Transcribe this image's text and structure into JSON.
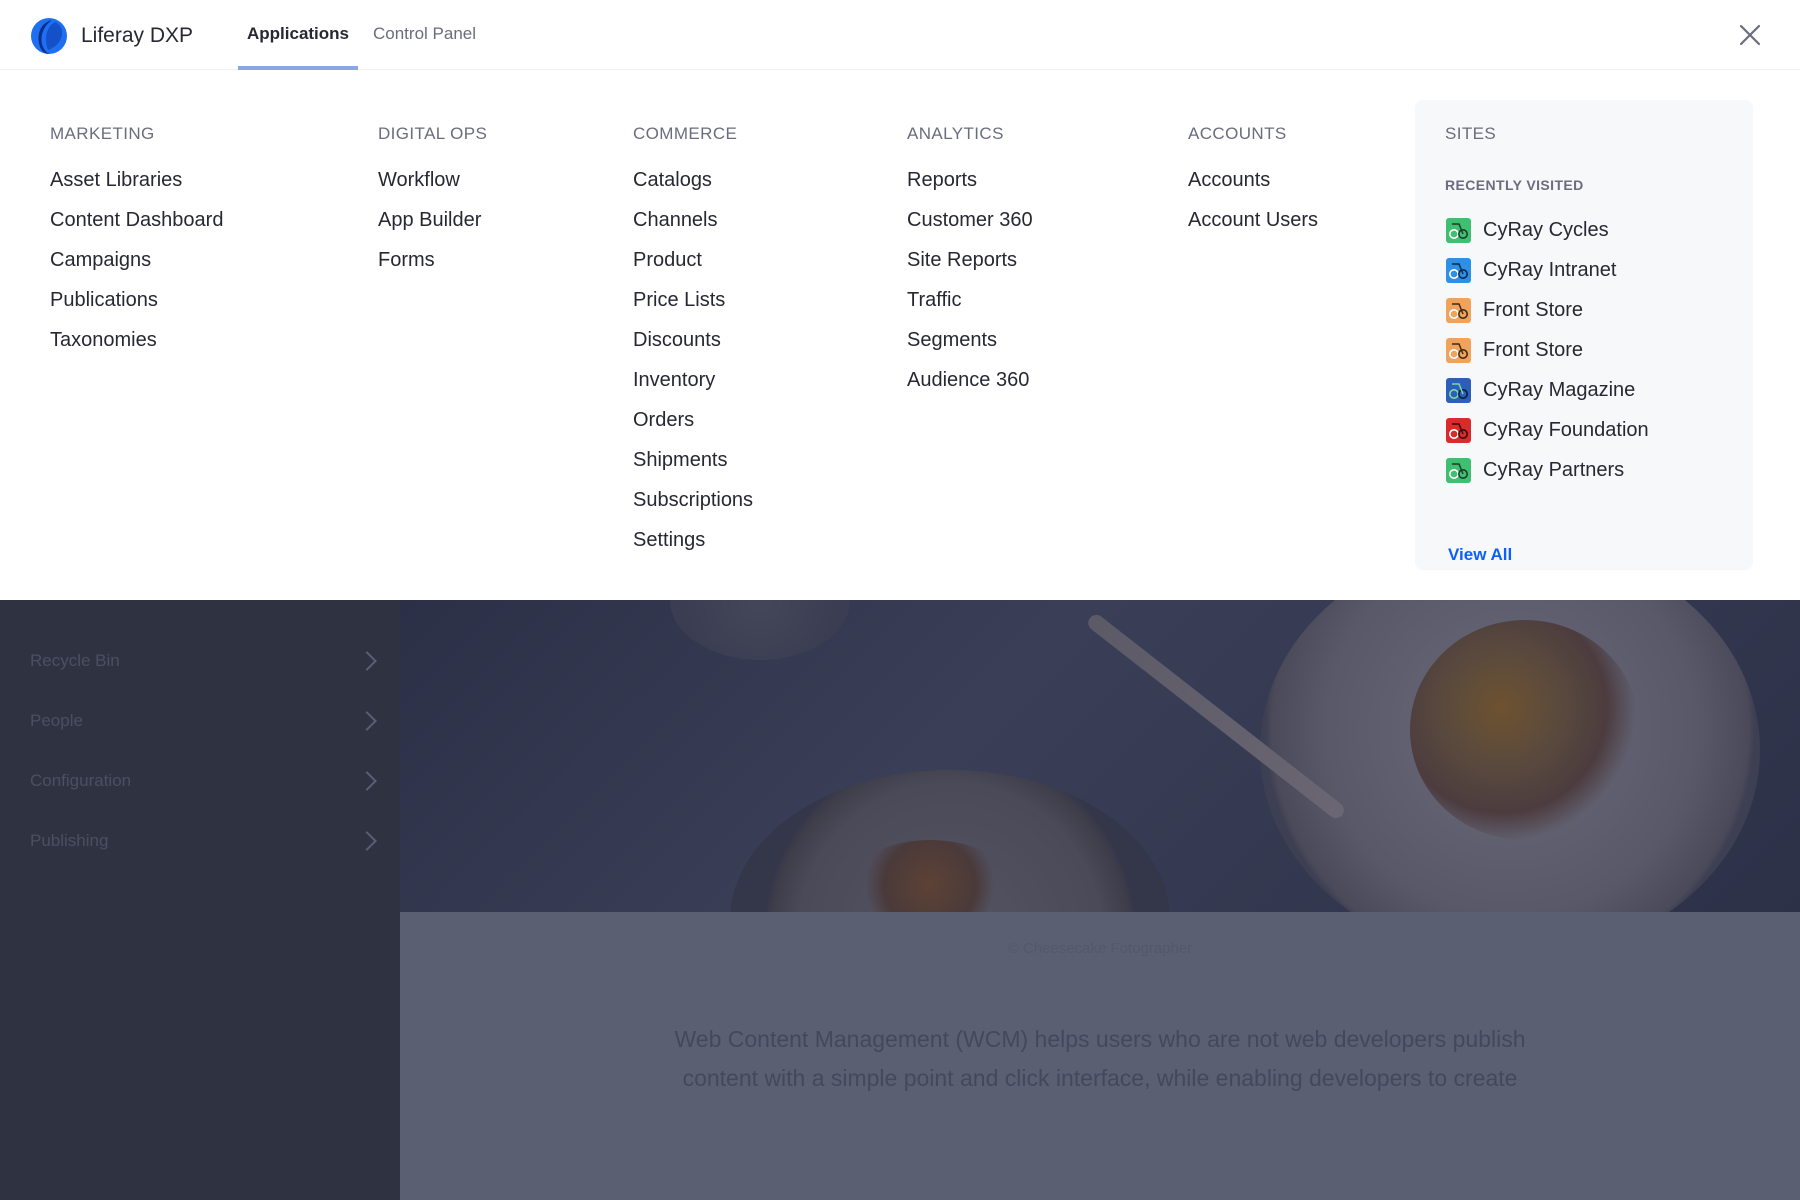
{
  "header": {
    "brand": "Liferay DXP",
    "tabs": [
      "Applications",
      "Control Panel"
    ],
    "active_tab": "Applications"
  },
  "menu": {
    "columns": [
      {
        "heading": "MARKETING",
        "items": [
          "Asset Libraries",
          "Content Dashboard",
          "Campaigns",
          "Publications",
          "Taxonomies"
        ]
      },
      {
        "heading": "DIGITAL OPS",
        "items": [
          "Workflow",
          "App Builder",
          "Forms"
        ]
      },
      {
        "heading": "COMMERCE",
        "items": [
          "Catalogs",
          "Channels",
          "Product",
          "Price Lists",
          "Discounts",
          "Inventory",
          "Orders",
          "Shipments",
          "Subscriptions",
          "Settings"
        ]
      },
      {
        "heading": "ANALYTICS",
        "items": [
          "Reports",
          "Customer 360",
          "Site Reports",
          "Traffic",
          "Segments",
          "Audience 360"
        ]
      },
      {
        "heading": "ACCOUNTS",
        "items": [
          "Accounts",
          "Account Users"
        ]
      }
    ],
    "sites": {
      "heading": "SITES",
      "recent_label": "RECENTLY VISITED",
      "items": [
        {
          "name": "CyRay Cycles",
          "color": "#3fbf6f"
        },
        {
          "name": "CyRay Intranet",
          "color": "#2e8fe6"
        },
        {
          "name": "Front Store",
          "color": "#f0a35c"
        },
        {
          "name": "Front Store",
          "color": "#f0a35c"
        },
        {
          "name": "CyRay Magazine",
          "color": "#2c5fb8"
        },
        {
          "name": "CyRay Foundation",
          "color": "#d92b2b"
        },
        {
          "name": "CyRay Partners",
          "color": "#3fbf6f"
        }
      ],
      "view_all": "View All"
    }
  },
  "background": {
    "sidebar_items": [
      "Recycle Bin",
      "People",
      "Configuration",
      "Publishing"
    ],
    "photo_credit": "© Cheesecake Fotographer",
    "description": "Web Content Management (WCM) helps users who are not web developers publish content with a simple point and click interface, while enabling developers to create"
  },
  "colors": {
    "accent": "#0b5fff",
    "tab_indicator": "#89a7e0",
    "sidebar_bg": "#2f3241",
    "sites_bg": "#f7f8f9"
  }
}
